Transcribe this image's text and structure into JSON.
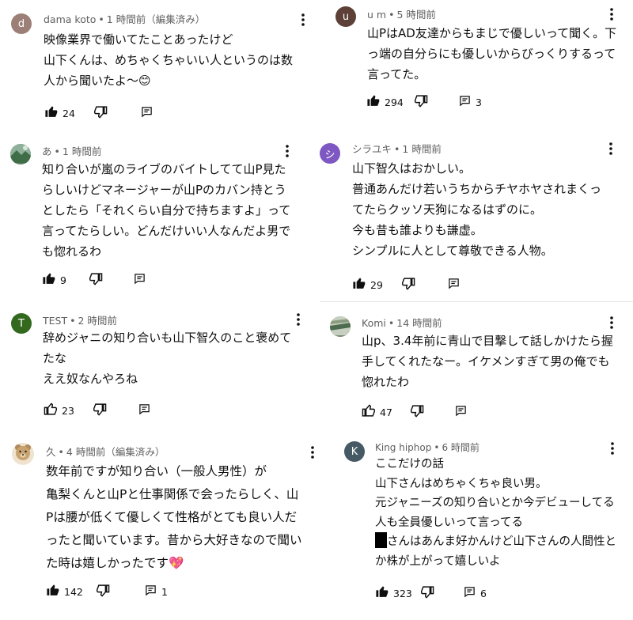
{
  "comments": [
    {
      "author": "dama koto",
      "dot": "•",
      "time": "1 時間前（編集済み）",
      "avatar": {
        "letter": "d",
        "color": "#9c7f76"
      },
      "lines": [
        "映像業界で働いてたことあったけど",
        "山下くんは、めちゃくちゃいい人というのは数",
        "人から聞いたよ〜😊"
      ],
      "likes": "24",
      "replies": "",
      "icons": {
        "like": "thumbs-up-filled-icon",
        "dislike": "thumbs-down-icon",
        "reply": "reply-icon",
        "more": "more-vert-icon"
      }
    },
    {
      "author": "u m",
      "dot": "•",
      "time": "5 時間前",
      "avatar": {
        "letter": "u",
        "color": "#5d4037"
      },
      "lines": [
        "山PはAD友達からもまじで優しいって聞く。下",
        "っ端の自分らにも優しいからびっくりするって",
        "言ってた。"
      ],
      "likes": "294",
      "replies": "3",
      "icons": {
        "like": "thumbs-up-filled-icon",
        "dislike": "thumbs-down-icon",
        "reply": "reply-icon",
        "more": "more-vert-icon"
      }
    },
    {
      "author": "あ",
      "dot": "•",
      "time": "1 時間前",
      "avatar": {
        "letter": "",
        "color": "#5f7f62",
        "image": "landscape-avatar"
      },
      "lines": [
        "知り合いが嵐のライブのバイトしてて山P見た",
        "らしいけどマネージャーが山Pのカバン持とう",
        "としたら「それくらい自分で持ちますよ」って",
        "言ってたらしい。どんだけいい人なんだよ男で",
        "も惚れるわ"
      ],
      "likes": "9",
      "replies": "",
      "icons": {
        "like": "thumbs-up-filled-icon",
        "dislike": "thumbs-down-icon",
        "reply": "reply-icon",
        "more": "more-vert-icon"
      }
    },
    {
      "author": "シラユキ",
      "dot": "•",
      "time": "1 時間前",
      "avatar": {
        "letter": "シ",
        "color": "#7e57c2"
      },
      "lines": [
        "山下智久はおかしい。",
        "普通あんだけ若いうちからチヤホヤされまくっ",
        "てたらクッソ天狗になるはずのに。",
        "今も昔も誰よりも謙虚。",
        "シンプルに人として尊敬できる人物。"
      ],
      "likes": "29",
      "replies": "",
      "icons": {
        "like": "thumbs-up-filled-icon",
        "dislike": "thumbs-down-icon",
        "reply": "reply-icon",
        "more": "more-vert-icon"
      }
    },
    {
      "author": "TEST",
      "dot": "•",
      "time": "2 時間前",
      "avatar": {
        "letter": "T",
        "color": "#33691e"
      },
      "lines": [
        "辞めジャニの知り合いも山下智久のこと褒めて",
        "たな",
        "ええ奴なんやろね"
      ],
      "likes": "23",
      "replies": "",
      "icons": {
        "like": "thumbs-up-outline-icon",
        "dislike": "thumbs-down-icon",
        "reply": "reply-icon",
        "more": "more-vert-icon"
      }
    },
    {
      "author": "Komi",
      "dot": "•",
      "time": "14 時間前",
      "avatar": {
        "letter": "",
        "color": "#7a8a72",
        "image": "landscape-avatar"
      },
      "lines": [
        "山p、3.4年前に青山で目撃して話しかけたら握",
        "手してくれたなー。イケメンすぎて男の俺でも",
        "惚れたわ"
      ],
      "likes": "47",
      "replies": "",
      "icons": {
        "like": "thumbs-up-outline-icon",
        "dislike": "thumbs-down-icon",
        "reply": "reply-icon",
        "more": "more-vert-icon"
      }
    },
    {
      "author": "久",
      "dot": "•",
      "time": "4 時間前（編集済み）",
      "avatar": {
        "letter": "",
        "color": "#d7c3a5",
        "image": "bear-avatar"
      },
      "lines": [
        "数年前ですが知り合い（一般人男性）が",
        "亀梨くんと山Pと仕事関係で会ったらしく、山",
        "Pは腰が低くて優しくて性格がとても良い人だ",
        "ったと聞いています。昔から大好きなので聞い",
        "た時は嬉しかったです💖"
      ],
      "likes": "142",
      "replies": "1",
      "icons": {
        "like": "thumbs-up-filled-icon",
        "dislike": "thumbs-down-icon",
        "reply": "reply-icon",
        "more": "more-vert-icon"
      }
    },
    {
      "author": "King hiphop",
      "dot": "•",
      "time": "6 時間前",
      "avatar": {
        "letter": "K",
        "color": "#455a64"
      },
      "lines": [
        "ここだけの話",
        "山下さんはめちゃくちゃ良い男。",
        "元ジャニーズの知り合いとか今デビューしてる",
        "人も全員優しいって言ってる",
        "さんはあんま好かんけど山下さんの人間性と",
        "か株が上がって嬉しいよ"
      ],
      "likes": "323",
      "replies": "6",
      "icons": {
        "like": "thumbs-up-filled-icon",
        "dislike": "thumbs-down-icon",
        "reply": "reply-icon",
        "more": "more-vert-icon"
      }
    }
  ]
}
